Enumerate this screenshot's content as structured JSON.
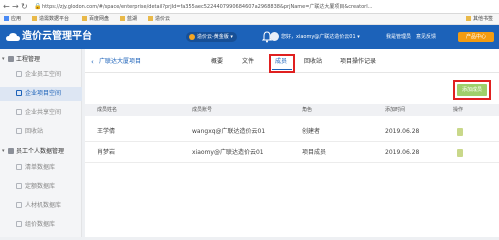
{
  "browser": {
    "url": "https://zjy.glodon.com/#/space/enterprise/detail?prjId=fa355aec5224407990684607a2968838&prjName=广联达大厦项目&creatorI...",
    "bookmarks": [
      "应用",
      "造需数据平台",
      "百度网盘",
      "蓝湖",
      "造价云",
      "其他书签"
    ]
  },
  "header": {
    "logo": "造价云管理平台",
    "org_pill": "造价云-黄金版",
    "user_text": "您好，xiaomy@广联达造价云01",
    "links": [
      "我是管理员",
      "意见反馈"
    ],
    "product_button": "产品中心"
  },
  "sidebar": {
    "sections": [
      {
        "label": "工程管理",
        "items": [
          {
            "label": "企业员工空间",
            "active": false
          },
          {
            "label": "企业项目空间",
            "active": true
          },
          {
            "label": "企业共享空间",
            "active": false
          },
          {
            "label": "回收站",
            "active": false
          }
        ]
      },
      {
        "label": "员工个人数据管理",
        "items": [
          {
            "label": "清单数据库",
            "active": false
          },
          {
            "label": "定额数据库",
            "active": false
          },
          {
            "label": "人材机数据库",
            "active": false
          },
          {
            "label": "组价数据库",
            "active": false
          }
        ]
      }
    ]
  },
  "main": {
    "back_icon": "chevron-left-icon",
    "project_title": "广联达大厦项目",
    "tabs": [
      "概要",
      "文件",
      "成员",
      "回收站",
      "项目操作记录"
    ],
    "active_tab": "成员",
    "add_button": "添加成员",
    "table": {
      "headers": [
        "成员姓名",
        "成员账号",
        "角色",
        "添加时间",
        "操作"
      ],
      "rows": [
        [
          "王学倩",
          "wangxq@广联达造价云01",
          "创建者",
          "2019.06.28"
        ],
        [
          "肖梦岩",
          "xiaomy@广联达造价云01",
          "项目成员",
          "2019.06.28"
        ]
      ]
    }
  },
  "colors": {
    "brand_blue": "#1c62b9",
    "highlight_red": "#e02020",
    "add_button_green": "#9fcf6b",
    "product_orange": "#f39c12"
  }
}
